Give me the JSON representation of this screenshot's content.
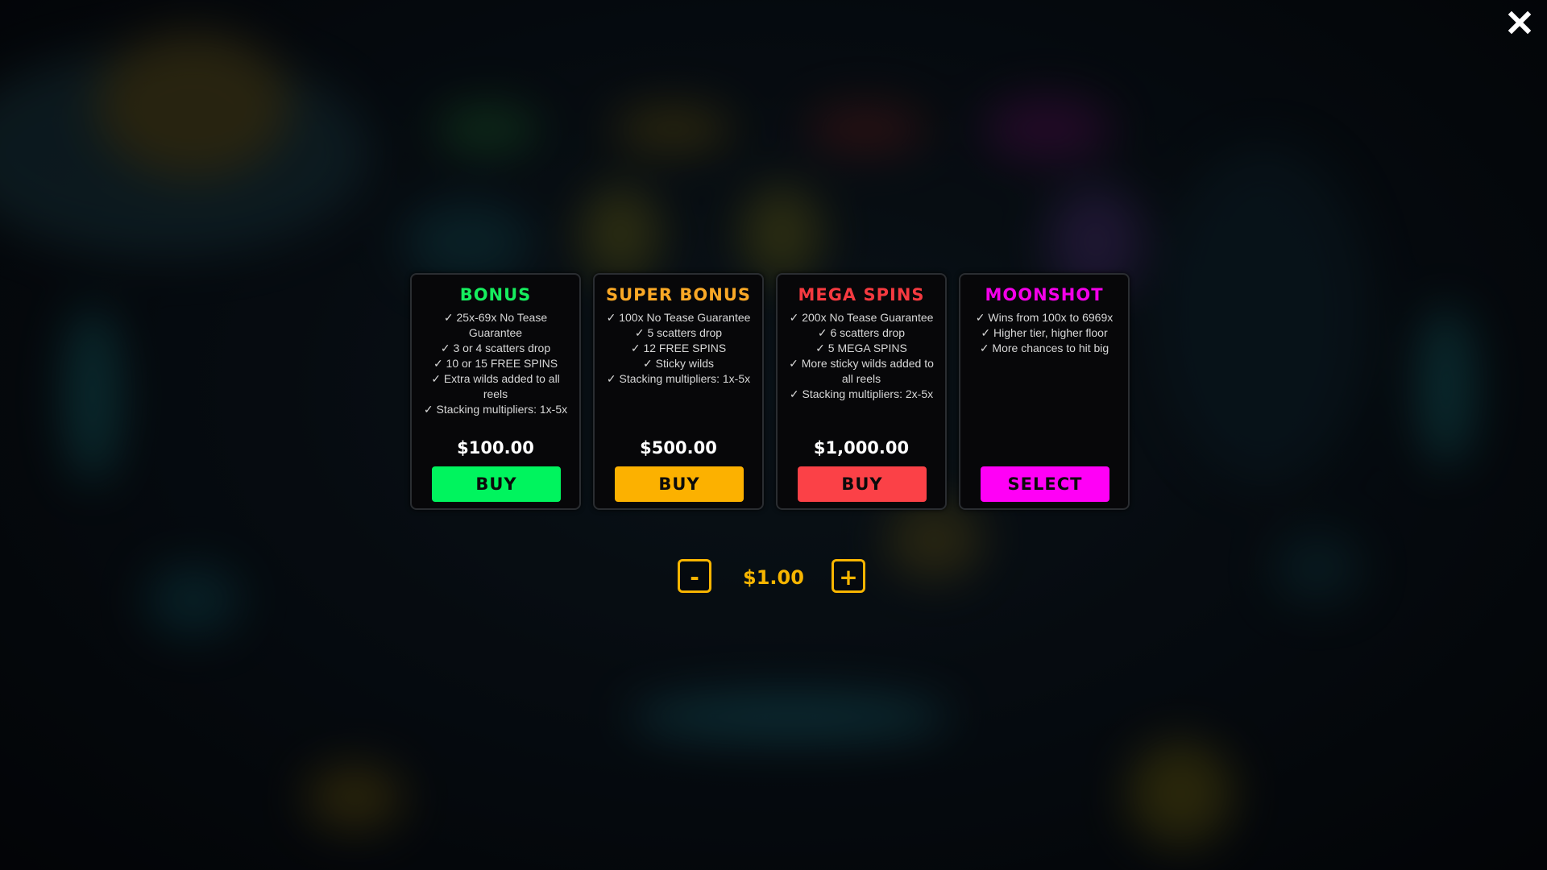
{
  "close": {
    "icon": "close-icon"
  },
  "packages": [
    {
      "title": "BONUS",
      "accent": "#16ee5e",
      "features": [
        "✓ 25x-69x No Tease Guarantee",
        "✓ 3 or 4 scatters drop",
        "✓ 10 or 15 FREE SPINS",
        "✓ Extra wilds added to all reels",
        "✓ Stacking multipliers: 1x-5x"
      ],
      "price": "$100.00",
      "button_label": "BUY",
      "button_color": "#00f45e"
    },
    {
      "title": "SUPER BONUS",
      "accent": "#f9a826",
      "features": [
        "✓ 100x No Tease Guarantee",
        "✓ 5 scatters drop",
        "✓ 12 FREE SPINS",
        "✓ Sticky wilds",
        "✓ Stacking multipliers: 1x-5x"
      ],
      "price": "$500.00",
      "button_label": "BUY",
      "button_color": "#fcb100"
    },
    {
      "title": "MEGA SPINS",
      "accent": "#f53a40",
      "features": [
        "✓ 200x No Tease Guarantee",
        "✓ 6 scatters drop",
        "✓ 5 MEGA SPINS",
        "✓ More sticky wilds added to all reels",
        "✓ Stacking multipliers: 2x-5x"
      ],
      "price": "$1,000.00",
      "button_label": "BUY",
      "button_color": "#fb4147"
    },
    {
      "title": "MOONSHOT",
      "accent": "#f300e9",
      "features": [
        "✓ Wins from 100x to 6969x",
        "✓ Higher tier, higher floor",
        "✓ More chances to hit big"
      ],
      "price": "",
      "button_label": "SELECT",
      "button_color": "#ff00f6"
    }
  ],
  "bet": {
    "decrease_label": "-",
    "value": "$1.00",
    "increase_label": "+",
    "color": "#f7b500"
  }
}
